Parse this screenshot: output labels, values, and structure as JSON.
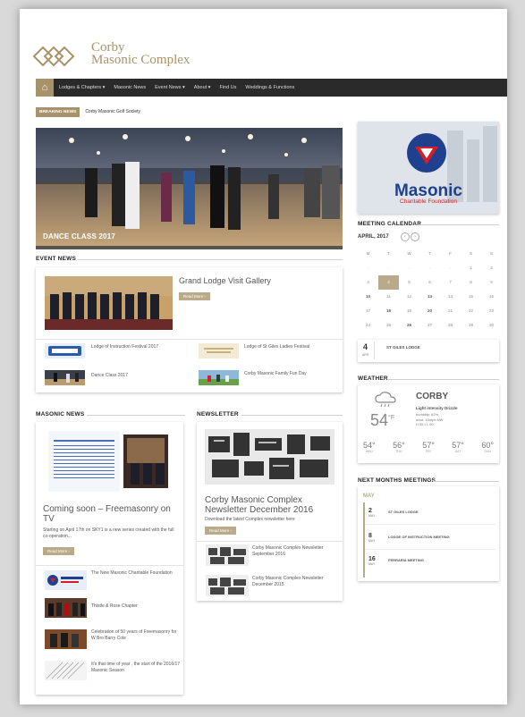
{
  "top": {
    "left": "",
    "right": ""
  },
  "brand": {
    "line1": "Corby",
    "line2": "Masonic Complex"
  },
  "nav": {
    "items": [
      "Lodges & Chapters ▾",
      "Masonic News",
      "Event News ▾",
      "About ▾",
      "Find Us",
      "Weddings & Functions"
    ]
  },
  "breaking": {
    "label": "BREAKING NEWS",
    "text": "Corby Masonic Golf Society"
  },
  "slider": {
    "caption": "DANCE CLASS 2017"
  },
  "event_news": {
    "title": "EVENT NEWS",
    "feature": {
      "title": "Grand Lodge Visit Gallery",
      "read_more": "Read More ›"
    },
    "items": [
      {
        "title": "Lodge of Instruction Festival 2017"
      },
      {
        "title": "Lodge of St Giles Ladies Festival"
      },
      {
        "title": "Dance Class 2017"
      },
      {
        "title": "Corby Masonic Family Fun Day"
      }
    ]
  },
  "masonic_news": {
    "title": "MASONIC NEWS",
    "feature": {
      "title": "Coming soon – Freemasonry on TV",
      "excerpt": "Starting on April 17th on SKY1 is a new series created with the full co-operation...",
      "read_more": "Read More ›"
    },
    "items": [
      {
        "title": "The New Masonic Charitable Foundation"
      },
      {
        "title": "Thistle & Rose Chapter"
      },
      {
        "title": "Celebration of 50 years of Freemasonry for W Bro Barry Cole"
      },
      {
        "title": "It's that time of year , the start of the 2016/17 Masonic Season"
      }
    ]
  },
  "newsletter": {
    "title": "NEWSLETTER",
    "feature": {
      "title": "Corby Masonic Complex Newsletter December 2016",
      "excerpt": "Download the latest Complex newsletter here",
      "read_more": "Read More ›"
    },
    "items": [
      {
        "title": "Corby Masonic Complex Newsletter September 2016"
      },
      {
        "title": "Corby Masonic Complex Newsletter December 2015"
      }
    ]
  },
  "ad": {
    "title": "Masonic",
    "subtitle": "Charitable Foundation"
  },
  "calendar": {
    "title": "MEETING CALENDAR",
    "month": "APRIL, 2017",
    "weekdays": [
      "M",
      "T",
      "W",
      "T",
      "F",
      "S",
      "S"
    ],
    "rows": [
      [
        "",
        "",
        "",
        "",
        "",
        "1",
        "2"
      ],
      [
        "3",
        "4",
        "5",
        "6",
        "7",
        "8",
        "9"
      ],
      [
        "10",
        "11",
        "12",
        "13",
        "14",
        "15",
        "16"
      ],
      [
        "17",
        "18",
        "19",
        "20",
        "21",
        "22",
        "23"
      ],
      [
        "24",
        "25",
        "26",
        "27",
        "28",
        "29",
        "30"
      ]
    ],
    "today": "4",
    "event_days": [
      "10",
      "13",
      "18",
      "20",
      "26"
    ],
    "selected": {
      "day": "4",
      "weekday": "APR",
      "title": "ST GILES LODGE"
    }
  },
  "weather": {
    "title": "WEATHER",
    "city": "CORBY",
    "condition": "Light intensity Drizzle",
    "details": [
      "humidity: 62%",
      "wind: 15mph NW",
      "H 55 • L 50"
    ],
    "temp": "54",
    "unit": "°F",
    "forecast": [
      {
        "t": "54°",
        "d": "WED"
      },
      {
        "t": "56°",
        "d": "THU"
      },
      {
        "t": "57°",
        "d": "FRI"
      },
      {
        "t": "57°",
        "d": "SAT"
      },
      {
        "t": "60°",
        "d": "SUN"
      }
    ]
  },
  "next_months": {
    "title": "NEXT MONTHS MEETINGS",
    "month": "MAY",
    "items": [
      {
        "day": "2",
        "mon": "MAY",
        "title": "ST GILES LODGE"
      },
      {
        "day": "8",
        "mon": "MAY",
        "title": "LODGE OF INSTRUCTION MEETING"
      },
      {
        "day": "16",
        "mon": "MAY",
        "title": "FERRARIA MEETING"
      }
    ]
  },
  "colors": {
    "accent": "#a8926a",
    "nav": "#2a2a2a",
    "masonic_blue": "#1f3f8f",
    "masonic_red": "#d21f27"
  }
}
